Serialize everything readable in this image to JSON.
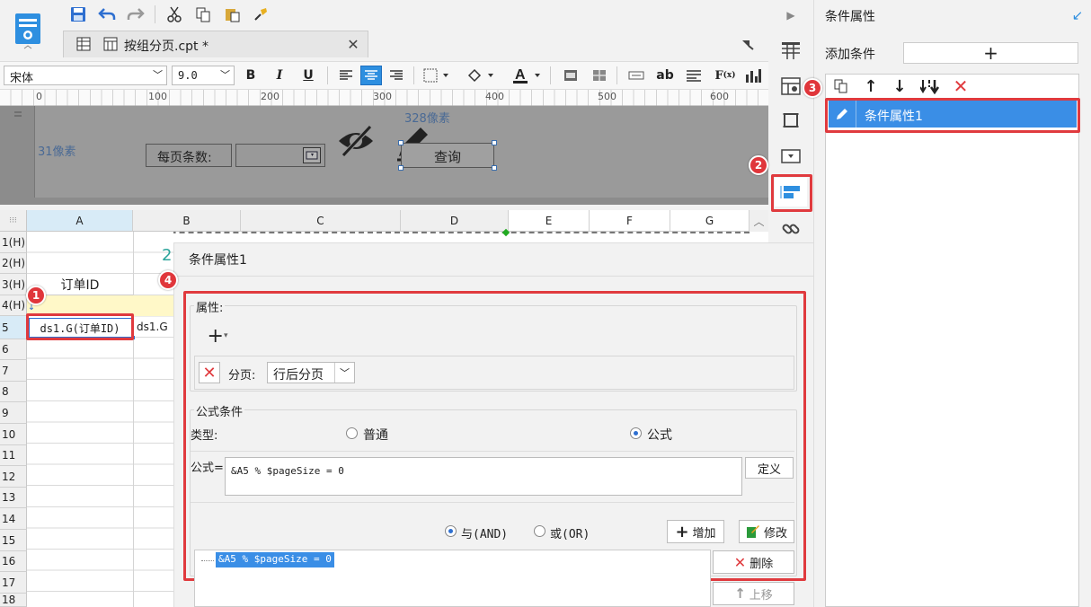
{
  "tab": {
    "title": "按组分页.cpt *"
  },
  "font": {
    "family": "宋体",
    "size": "9.0"
  },
  "ruler": {
    "ticks": [
      "0",
      "100",
      "200",
      "300",
      "400",
      "500",
      "600"
    ]
  },
  "param_pane": {
    "label_31": "31像素",
    "label_328": "328像素",
    "per_page_label": "每页条数:",
    "query_button": "查询"
  },
  "grid": {
    "columns": [
      "A",
      "B",
      "C",
      "D",
      "E",
      "F",
      "G"
    ],
    "rows": [
      "1(H)",
      "2(H)",
      "3(H)",
      "4(H)",
      "5",
      "6",
      "7",
      "8",
      "9",
      "10",
      "11",
      "12",
      "13",
      "14",
      "15",
      "16",
      "17",
      "18"
    ],
    "header_cell_a3": "订单ID",
    "cell_a5": "ds1.G(订单ID)",
    "cell_b5": "ds1.G",
    "cell_b2_fragment": "2"
  },
  "right_panel": {
    "title": "条件属性",
    "add_condition_label": "添加条件",
    "list_items": [
      "条件属性1"
    ]
  },
  "dialog": {
    "title": "条件属性1",
    "properties_section": "属性:",
    "page_label": "分页:",
    "page_value": "行后分页",
    "formula_section": "公式条件",
    "type_label": "类型:",
    "type_normal": "普通",
    "type_formula": "公式",
    "type_selected": "公式",
    "formula_label": "公式=",
    "formula_value": "&A5 % $pageSize = 0",
    "define_button": "定义",
    "and_label": "与(AND)",
    "or_label": "或(OR)",
    "logic_selected": "与(AND)",
    "add_button": "增加",
    "modify_button": "修改",
    "delete_button": "删除",
    "move_up_button": "上移",
    "conditions": [
      "&A5 % $pageSize = 0"
    ]
  },
  "badges": [
    "1",
    "2",
    "3",
    "4"
  ],
  "colors": {
    "accent_blue": "#2e8fe0",
    "highlight_red": "#e03a3e",
    "selected_row": "#3a8ee6"
  }
}
